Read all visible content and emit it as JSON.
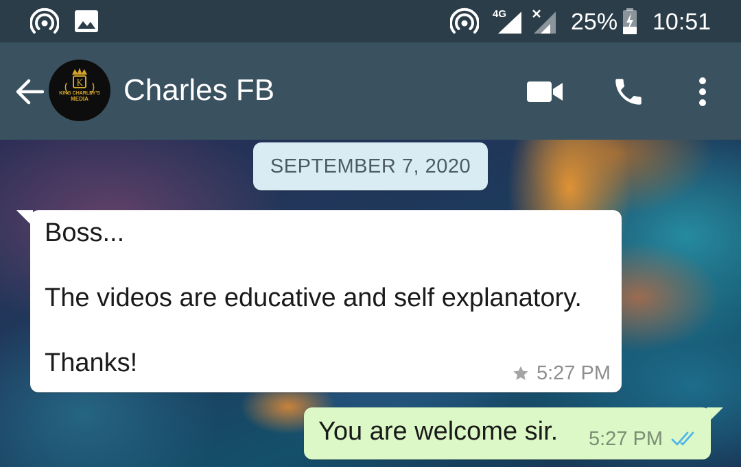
{
  "status_bar": {
    "battery_percent": "25%",
    "clock": "10:51",
    "network_label": "4G",
    "icons": [
      "hotspot-icon",
      "gallery-icon",
      "hotspot-icon",
      "signal-4g-icon",
      "signal-no-service-icon",
      "battery-charging-icon"
    ]
  },
  "header": {
    "contact_name": "Charles FB",
    "avatar_text": {
      "line1": "KING CHARLEY'S",
      "line2": "MEDIA",
      "monogram": "K"
    },
    "actions": [
      "video-call-icon",
      "phone-call-icon",
      "more-options-icon"
    ]
  },
  "chat": {
    "date_divider": "SEPTEMBER 7, 2020",
    "messages": [
      {
        "direction": "incoming",
        "text": "Boss...\n\nThe videos are educative and self explanatory.\n\nThanks!",
        "time": "5:27 PM",
        "starred": true
      },
      {
        "direction": "outgoing",
        "text": "You are welcome sir.",
        "time": "5:27 PM",
        "status": "read"
      }
    ]
  },
  "colors": {
    "status_bar_bg": "#2b3d48",
    "app_bar_bg": "#3a5260",
    "incoming_bubble": "#ffffff",
    "outgoing_bubble": "#dcf8c6",
    "date_chip_bg": "#d9ecf4",
    "read_ticks": "#4fb6ec",
    "avatar_gold": "#d4a52c"
  }
}
